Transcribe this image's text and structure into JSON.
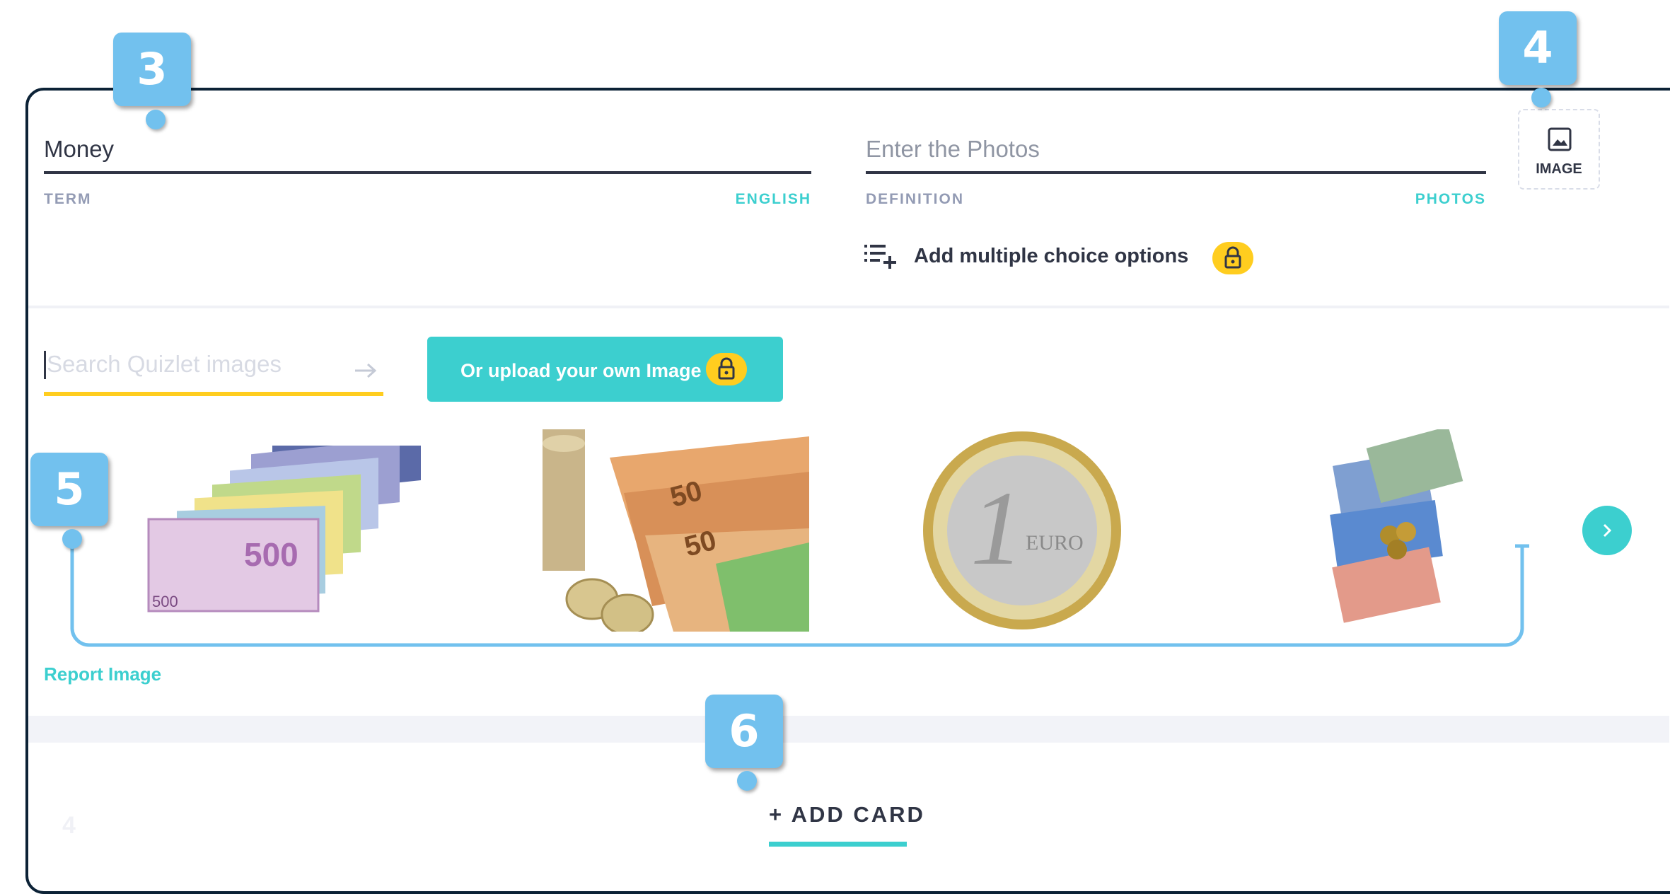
{
  "term": {
    "value": "Money",
    "label": "TERM",
    "language": "ENGLISH"
  },
  "definition": {
    "placeholder": "Enter the Photos",
    "label": "DEFINITION",
    "language": "PHOTOS"
  },
  "image_button": {
    "label": "IMAGE"
  },
  "multiple_choice": {
    "label": "Add multiple choice options"
  },
  "image_search": {
    "placeholder": "Search Quizlet images",
    "upload_label": "Or upload your own Image"
  },
  "report_label": "Report Image",
  "add_card_label": "+ ADD CARD",
  "ghost_card_number": "4",
  "callouts": {
    "c3": "3",
    "c4": "4",
    "c5": "5",
    "c6": "6"
  },
  "colors": {
    "accent_teal": "#3ccfcf",
    "lock_yellow": "#ffcd1f",
    "callout_blue": "#72c1ee",
    "frame_navy": "#0c2236"
  },
  "icons": [
    "image-icon",
    "list-plus-icon",
    "lock-icon",
    "arrow-right-icon",
    "chevron-right-icon"
  ]
}
